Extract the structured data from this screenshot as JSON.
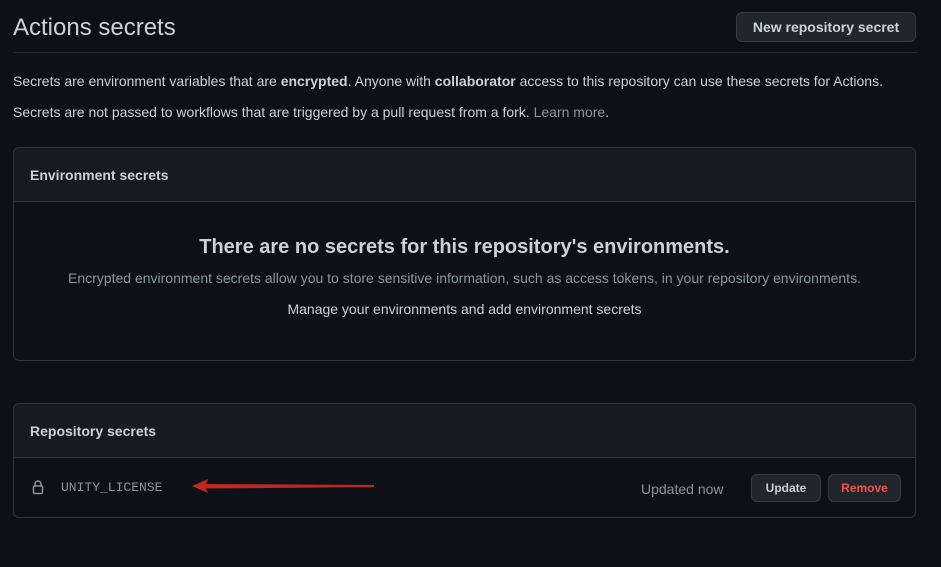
{
  "header": {
    "title": "Actions secrets",
    "new_secret_label": "New repository secret"
  },
  "description": {
    "line1_a": "Secrets are environment variables that are ",
    "line1_b": "encrypted",
    "line1_c": ". Anyone with ",
    "line1_d": "collaborator",
    "line1_e": " access to this repository can use these secrets for Actions.",
    "line2_a": "Secrets are not passed to workflows that are triggered by a pull request from a fork. ",
    "line2_link": "Learn more",
    "line2_end": "."
  },
  "environment_secrets": {
    "heading": "Environment secrets",
    "empty_title": "There are no secrets for this repository's environments.",
    "empty_description": "Encrypted environment secrets allow you to store sensitive information, such as access tokens, in your repository environments.",
    "manage_link": "Manage your environments and add environment secrets"
  },
  "repository_secrets": {
    "heading": "Repository secrets",
    "items": [
      {
        "name": "UNITY_LICENSE",
        "updated": "Updated now",
        "update_label": "Update",
        "remove_label": "Remove",
        "icon": "lock-icon"
      }
    ]
  },
  "colors": {
    "background": "#0d1117",
    "panel_header": "#161b22",
    "border": "#30363d",
    "danger": "#f85149",
    "annotation_arrow": "#c0281f"
  }
}
